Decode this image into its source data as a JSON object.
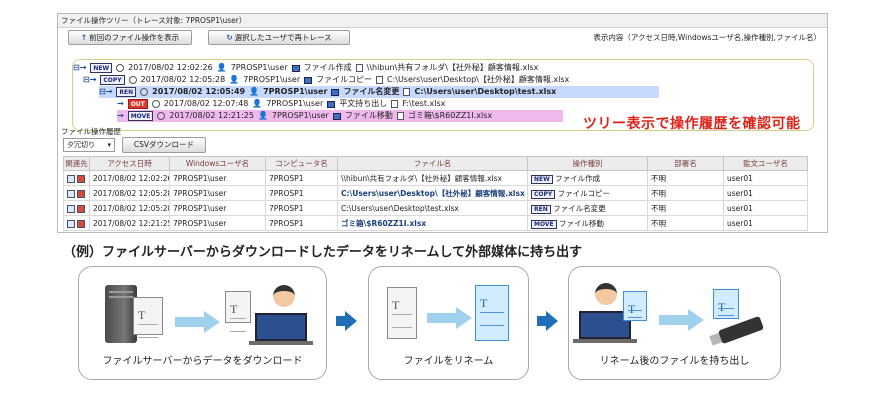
{
  "window": {
    "title": "ファイル操作ツリー（トレース対象: 7PROSP1\\user）",
    "back_button": "前回のファイル操作を表示",
    "retrace_button": "選択したユーザで再トレース",
    "display_content": "表示内容（アクセス日時,Windowsユーザ名,操作種別,ファイル名）"
  },
  "tree": {
    "rows": [
      {
        "badge": "NEW",
        "time": "2017/08/02 12:02:26",
        "user": "7PROSP1\\user",
        "op": "ファイル作成",
        "file": "\\\\hibun\\共有フォルダ\\【社外秘】顧客情報.xlsx"
      },
      {
        "badge": "COPY",
        "time": "2017/08/02 12:05:28",
        "user": "7PROSP1\\user",
        "op": "ファイルコピー",
        "file": "C:\\Users\\user\\Desktop\\【社外秘】顧客情報.xlsx"
      },
      {
        "badge": "REN",
        "time": "2017/08/02 12:05:49",
        "user": "7PROSP1\\user",
        "op": "ファイル名変更",
        "file": "C:\\Users\\user\\Desktop\\test.xlsx"
      },
      {
        "badge": "OUT",
        "time": "2017/08/02 12:07:48",
        "user": "7PROSP1\\user",
        "op": "平文持ち出し",
        "file": "F:\\test.xlsx"
      },
      {
        "badge": "MOVE",
        "time": "2017/08/02 12:21:25",
        "user": "7PROSP1\\user",
        "op": "ファイル移動",
        "file": "ゴミ箱\\$R60ZZ1I.xlsx"
      }
    ],
    "callout": "ツリー表示で操作履歴を確認可能"
  },
  "history": {
    "label": "ファイル操作履歴",
    "select_value": "夕冗切り",
    "csv_button": "CSVダウンロード",
    "columns": [
      "関連先",
      "アクセス日時",
      "Windowsユーザ名",
      "コンピュータ名",
      "ファイル名",
      "操作種別",
      "部署名",
      "監文ユーザ名"
    ],
    "rows": [
      {
        "time": "2017/08/02 12:02:26",
        "user": "7PROSP1\\user",
        "computer": "7PROSP1",
        "file": "\\\\hibun\\共有フォルダ\\【社外秘】顧客情報.xlsx",
        "badge": "NEW",
        "op": "ファイル作成",
        "dept": "不明",
        "kanbun": "user01"
      },
      {
        "time": "2017/08/02 12:05:28",
        "user": "7PROSP1\\user",
        "computer": "7PROSP1",
        "file": "C:\\Users\\user\\Desktop\\【社外秘】顧客情報.xlsx",
        "badge": "COPY",
        "op": "ファイルコピー",
        "dept": "不明",
        "kanbun": "user01"
      },
      {
        "time": "2017/08/02 12:05:28",
        "user": "7PROSP1\\user",
        "computer": "7PROSP1",
        "file": "C:\\Users\\user\\Desktop\\test.xlsx",
        "badge": "REN",
        "op": "ファイル名変更",
        "dept": "不明",
        "kanbun": "user01"
      },
      {
        "time": "2017/08/02 12:21:25",
        "user": "7PROSP1\\user",
        "computer": "7PROSP1",
        "file": "ゴミ箱\\$R60ZZ1I.xlsx",
        "badge": "MOVE",
        "op": "ファイル移動",
        "dept": "不明",
        "kanbun": "user01"
      }
    ]
  },
  "caption": "（例）ファイルサーバーからダウンロードしたデータをリネームして外部媒体に持ち出す",
  "flow": {
    "panels": [
      {
        "label": "ファイルサーバーからデータをダウンロード"
      },
      {
        "label": "ファイルをリネーム"
      },
      {
        "label": "リネーム後のファイルを持ち出し"
      }
    ]
  },
  "colors": {
    "accent": "#1f6fb8",
    "callout": "#e0231a",
    "highlight_blue": "#c8d9ff",
    "highlight_pink": "#f0b9ee"
  }
}
